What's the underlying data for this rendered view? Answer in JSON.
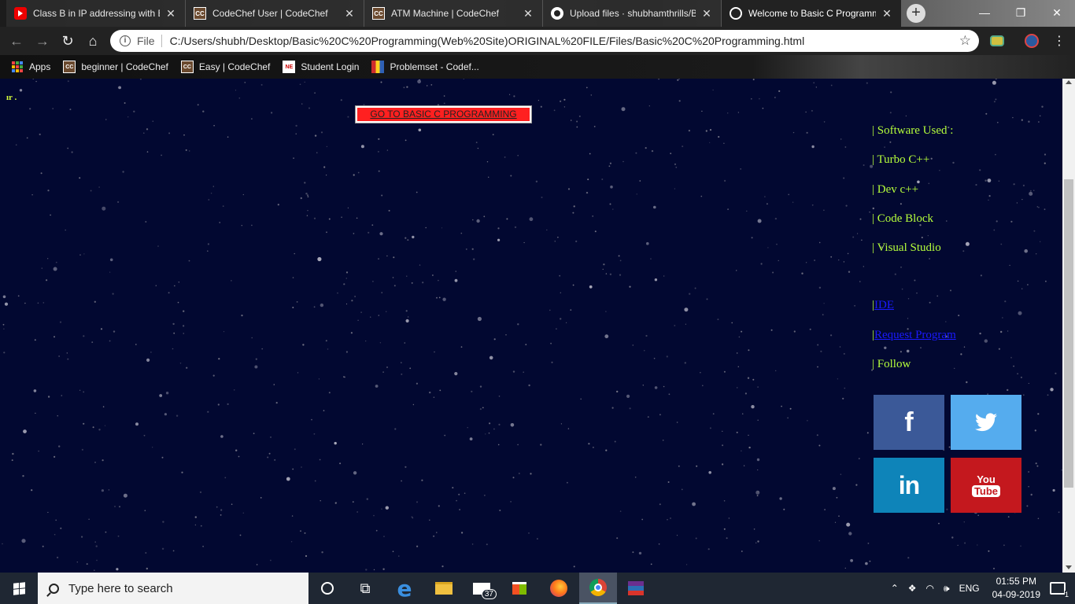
{
  "browser": {
    "tabs": [
      {
        "title": "Class B in IP addressing with E",
        "icon": "youtube-icon",
        "active": false
      },
      {
        "title": "CodeChef User | CodeChef",
        "icon": "codechef-icon",
        "active": false
      },
      {
        "title": "ATM Machine | CodeChef",
        "icon": "codechef-icon",
        "active": false
      },
      {
        "title": "Upload files · shubhamthrills/B",
        "icon": "github-icon",
        "active": false
      },
      {
        "title": "Welcome to Basic C Programm",
        "icon": "globe-icon",
        "active": true
      }
    ],
    "address": {
      "scheme_label": "File",
      "url": "C:/Users/shubh/Desktop/Basic%20C%20Programming(Web%20Site)ORIGINAL%20FILE/Files/Basic%20C%20Programming.html"
    },
    "bookmarks": [
      {
        "label": "Apps",
        "icon": "apps-grid-icon"
      },
      {
        "label": "beginner | CodeChef",
        "icon": "codechef-icon"
      },
      {
        "label": "Easy | CodeChef",
        "icon": "codechef-icon"
      },
      {
        "label": "Student Login",
        "icon": "ne-icon"
      },
      {
        "label": "Problemset - Codef...",
        "icon": "codeforces-icon"
      }
    ]
  },
  "page": {
    "snippet": "ır .",
    "go_button": "GO TO BASIC C PROGRAMMING",
    "sidebar": {
      "separator": "|",
      "software_heading": "Software Used :",
      "software": [
        "Turbo C++",
        "Dev c++",
        "Code Block",
        "Visual Studio"
      ],
      "links": [
        "IDE",
        "Request Program"
      ],
      "follow_label": "Follow"
    },
    "social": [
      {
        "name": "facebook",
        "icon": "facebook-icon",
        "glyph": "f",
        "color": "#3b5998"
      },
      {
        "name": "twitter",
        "icon": "twitter-icon",
        "color": "#55acee"
      },
      {
        "name": "linkedin",
        "icon": "linkedin-icon",
        "glyph": "in",
        "color": "#0e84b9"
      },
      {
        "name": "youtube",
        "icon": "youtube-icon",
        "glyph_top": "You",
        "glyph_bottom": "Tube",
        "color": "#c4181e"
      }
    ],
    "colors": {
      "background": "#020831",
      "text_green": "#b6ff3b",
      "link_blue": "#1a1aff",
      "button_red": "#ff2020"
    }
  },
  "taskbar": {
    "search_placeholder": "Type here to search",
    "mail_badge": "37",
    "language": "ENG",
    "time": "01:55 PM",
    "date": "04-09-2019",
    "notification_count": "1"
  }
}
